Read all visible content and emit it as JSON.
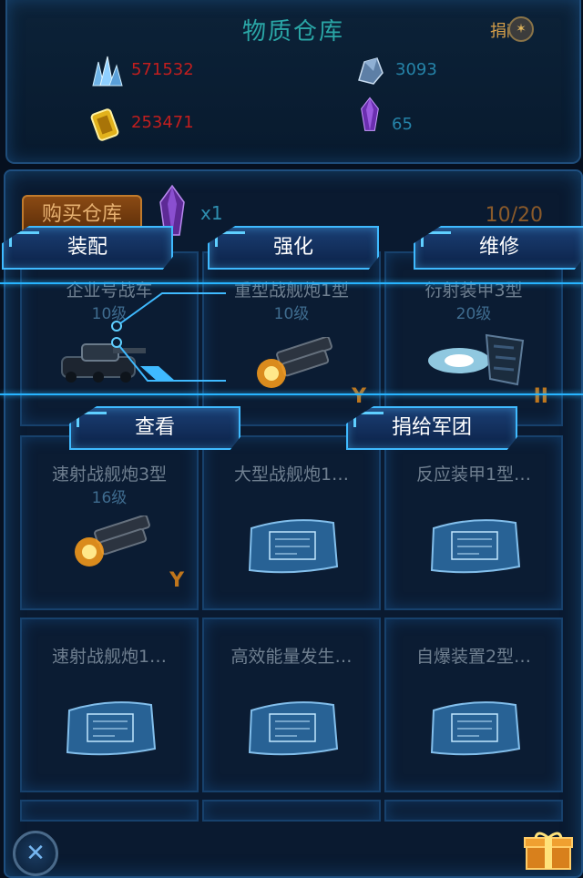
{
  "header": {
    "title": "物质仓库",
    "donate_label": "捐献",
    "resources": [
      {
        "icon": "blue-crystal-cluster-icon",
        "value": "571532",
        "color": "#c21e1e"
      },
      {
        "icon": "gold-energy-cell-icon",
        "value": "253471",
        "color": "#c21e1e"
      },
      {
        "icon": "blue-ore-icon",
        "value": "3093",
        "color": "#2583a8"
      },
      {
        "icon": "purple-crystal-icon",
        "value": "65",
        "color": "#2583a8"
      }
    ]
  },
  "storage": {
    "buy_label": "购买仓库",
    "quantity": "x1",
    "capacity": "10/20"
  },
  "items": [
    {
      "name": "企业号战车",
      "level": "10级",
      "art": "tank"
    },
    {
      "name": "重型战舰炮1型",
      "level": "10级",
      "art": "cannon",
      "rank": "Y"
    },
    {
      "name": "衍射装甲3型",
      "level": "20级",
      "art": "armor",
      "rank": "II"
    },
    {
      "name": "速射战舰炮3型",
      "level": "16级",
      "art": "cannon",
      "rank": "Y"
    },
    {
      "name": "大型战舰炮1…",
      "level": "",
      "art": "blueprint"
    },
    {
      "name": "反应装甲1型…",
      "level": "",
      "art": "blueprint"
    },
    {
      "name": "速射战舰炮1…",
      "level": "",
      "art": "blueprint"
    },
    {
      "name": "高效能量发生…",
      "level": "",
      "art": "blueprint"
    },
    {
      "name": "自爆装置2型…",
      "level": "",
      "art": "blueprint"
    }
  ],
  "context_menu": {
    "equip": "装配",
    "upgrade": "强化",
    "repair": "维修",
    "view": "查看",
    "donate_to_legion": "捐给军团"
  },
  "footer": {
    "close_icon": "close-icon",
    "gift_icon": "gift-box-icon"
  }
}
